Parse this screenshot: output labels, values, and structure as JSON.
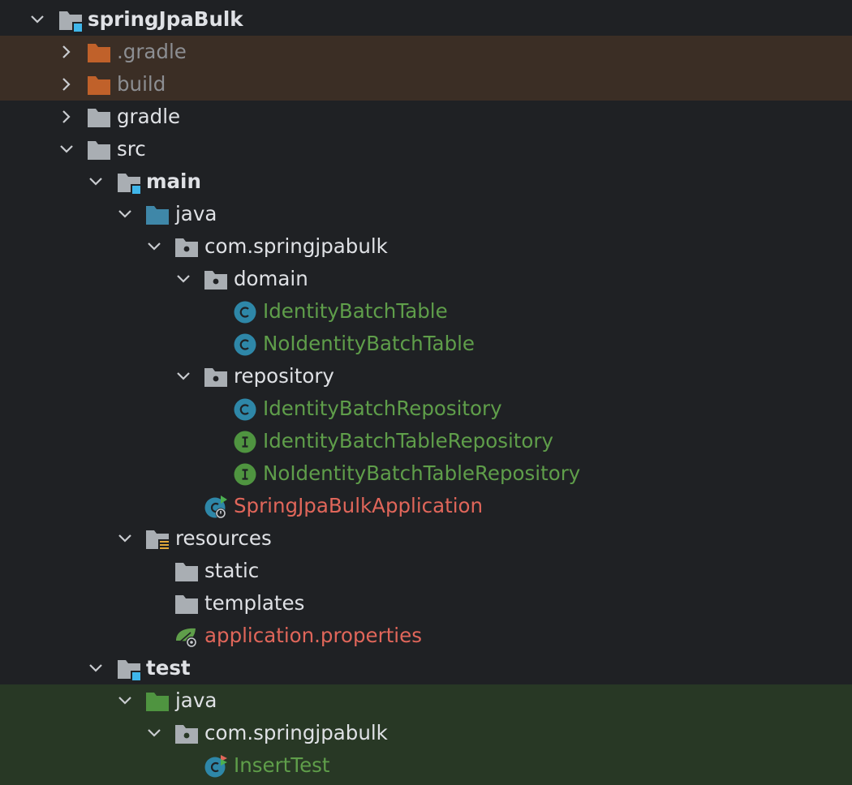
{
  "tree": {
    "root": {
      "label": "springJpaBulk"
    },
    "gradle_hidden": {
      "label": ".gradle"
    },
    "build": {
      "label": "build"
    },
    "gradle": {
      "label": "gradle"
    },
    "src": {
      "label": "src"
    },
    "main": {
      "label": "main"
    },
    "main_java": {
      "label": "java"
    },
    "main_pkg": {
      "label": "com.springjpabulk"
    },
    "domain": {
      "label": "domain"
    },
    "identity_batch_table": {
      "label": "IdentityBatchTable"
    },
    "no_identity_batch_table": {
      "label": "NoIdentityBatchTable"
    },
    "repository": {
      "label": "repository"
    },
    "identity_batch_repository": {
      "label": "IdentityBatchRepository"
    },
    "identity_batch_table_repository": {
      "label": "IdentityBatchTableRepository"
    },
    "no_identity_batch_table_repository": {
      "label": "NoIdentityBatchTableRepository"
    },
    "app": {
      "label": "SpringJpaBulkApplication"
    },
    "resources": {
      "label": "resources"
    },
    "static": {
      "label": "static"
    },
    "templates": {
      "label": "templates"
    },
    "app_props": {
      "label": "application.properties"
    },
    "test": {
      "label": "test"
    },
    "test_java": {
      "label": "java"
    },
    "test_pkg": {
      "label": "com.springjpabulk"
    },
    "insert_test": {
      "label": "InsertTest"
    }
  },
  "colors": {
    "background": "#1f2124",
    "excluded_row": "#3b2e25",
    "test_row": "#283825",
    "folder_gray": "#a9aeb3",
    "folder_excluded": "#c0612a",
    "source_folder": "#3f87a8",
    "test_folder": "#4f9440",
    "class_icon": "#2e87a8",
    "interface_icon": "#4f9440",
    "text_default": "#dfe1e5",
    "text_green": "#5f9e4a",
    "text_red": "#e0665a",
    "text_dim": "#8c8e92"
  }
}
